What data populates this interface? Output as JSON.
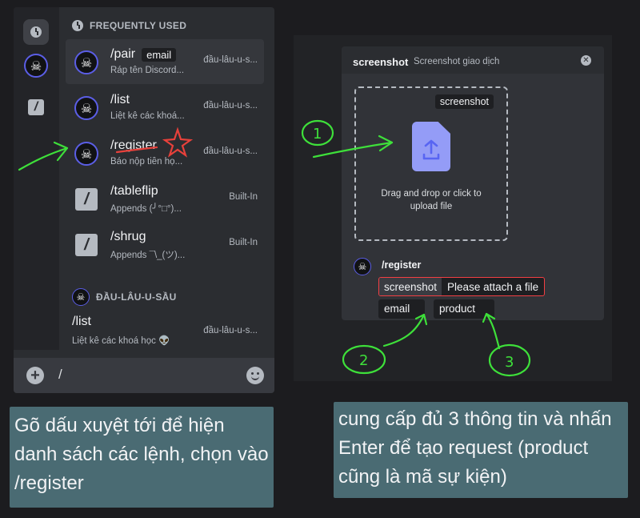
{
  "left": {
    "section_frequent": "FREQUENTLY USED",
    "commands": [
      {
        "name": "/pair",
        "option": "email",
        "desc": "Ráp tên Discord...",
        "source": "đầu-lâu-u-s..."
      },
      {
        "name": "/list",
        "option": "",
        "desc": "Liệt kê các khoá...",
        "source": "đầu-lâu-u-s..."
      },
      {
        "name": "/register",
        "option": "",
        "desc": "Báo nộp tiền họ...",
        "source": "đầu-lâu-u-s..."
      },
      {
        "name": "/tableflip",
        "option": "",
        "desc": "Appends (╯°□°)...",
        "source": "Built-In"
      },
      {
        "name": "/shrug",
        "option": "",
        "desc": "Appends ¯\\_(ツ)...",
        "source": "Built-In"
      }
    ],
    "section_bot": "ĐẦU-LÂU-U-SẦU",
    "bot_command": {
      "name": "/list",
      "desc": "Liệt kê các khoá học 👽",
      "source": "đầu-lâu-u-s..."
    },
    "input_value": "/",
    "caption": "Gõ dấu xuyệt tới để hiện danh sách các lệnh, chọn vào /register"
  },
  "modal": {
    "title": "screenshot",
    "subtitle": "Screenshot giao dịch",
    "drop_tag": "screenshot",
    "drop_text": "Drag and drop or click to upload file",
    "command_title": "/register",
    "option_screenshot_key": "screenshot",
    "option_screenshot_value": "Please attach a file",
    "option_email": "email",
    "option_product": "product",
    "caption": "cung cấp đủ 3 thông tin và nhấn Enter để tạo request (product cũng là mã sự kiện)"
  },
  "annotations": {
    "n1": "1",
    "n2": "2",
    "n3": "3"
  },
  "colors": {
    "annotation_green": "#3ee03a",
    "star_red": "#e8413b",
    "accent": "#5b5ee6",
    "caption_bg": "#4a6b73"
  },
  "icons": {
    "recent": "clock-icon",
    "bot": "skull-avatar-icon",
    "builtin": "slash-icon",
    "upload": "upload-file-icon"
  }
}
